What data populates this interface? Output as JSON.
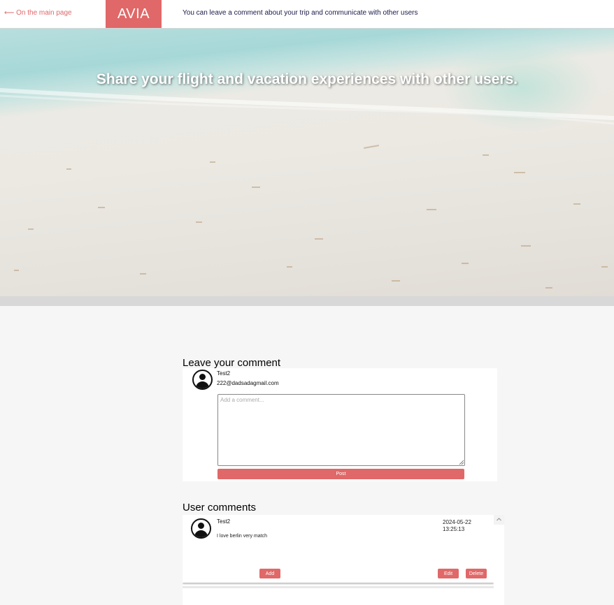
{
  "header": {
    "back_link": "⟵ On the main page",
    "logo": "AVIA",
    "note": "You can leave a comment about your trip and communicate with other users"
  },
  "hero": {
    "title": "Share your flight and vacation experiences with other users."
  },
  "leave_comment": {
    "title": "Leave your comment",
    "user_name": "Test2",
    "user_email": "222@dadsadagmail.com",
    "placeholder": "Add a comment...",
    "post_label": "Post"
  },
  "user_comments": {
    "title": "User comments",
    "items": [
      {
        "author": "Test2",
        "date": "2024-05-22",
        "time": "13:25:13",
        "text": "I love berlin very match",
        "add_label": "Add",
        "edit_label": "Edit",
        "delete_label": "Delete"
      }
    ]
  },
  "colors": {
    "accent": "#e06868",
    "page_background": "#f6f6f6"
  },
  "icons": {
    "avatar": "user-avatar-icon",
    "scroll_up": "chevron-up-icon",
    "resize": "resize-grip-icon"
  }
}
